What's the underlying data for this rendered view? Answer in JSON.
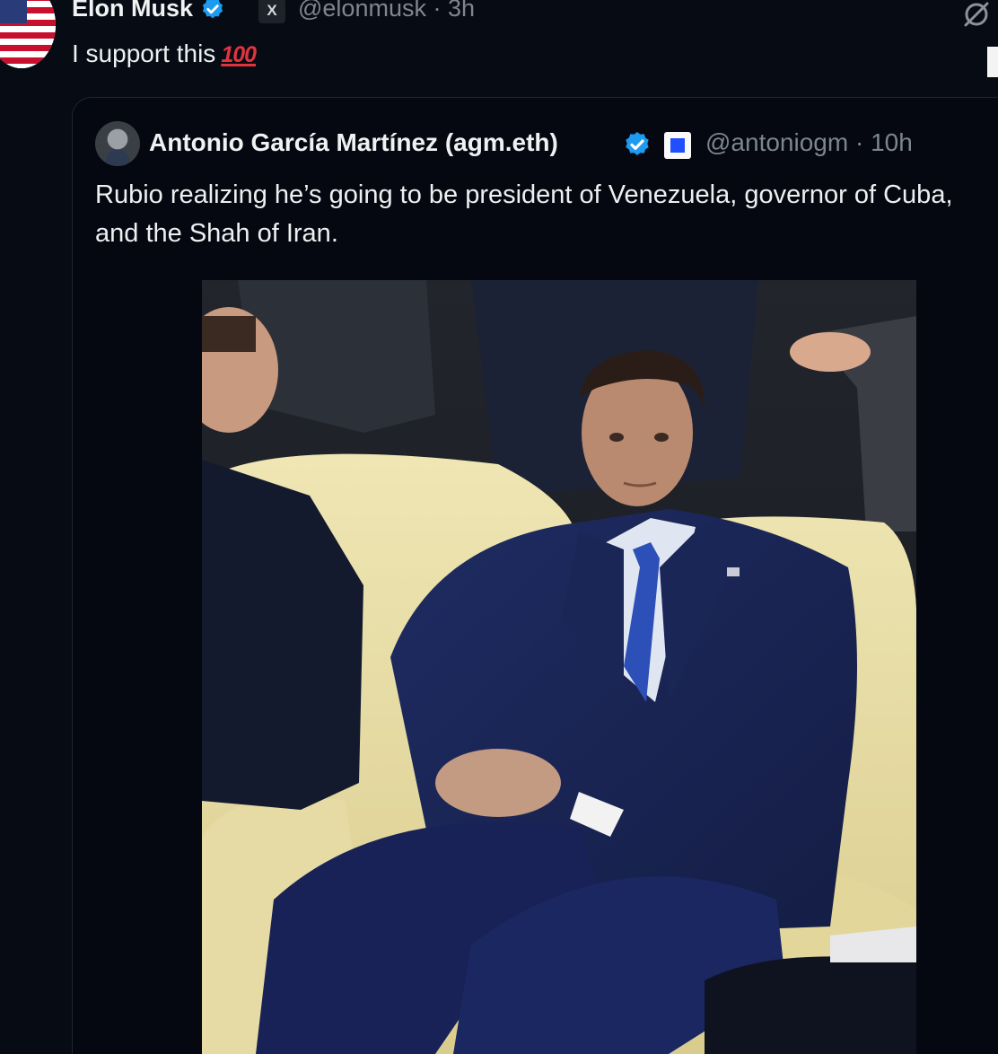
{
  "outer_tweet": {
    "name": "Elon Musk",
    "badge_letter": "X",
    "handle_time": "@elonmusk · 3h",
    "text": "I support this",
    "emoji": "100"
  },
  "quoted_tweet": {
    "name": "Antonio García Martínez (agm.eth)",
    "handle_time": "@antoniogm · 10h",
    "text": "Rubio realizing he’s going to be president of Venezuela, governor of Cuba, and the Shah of Iran."
  },
  "icons": {
    "verified": "verified-badge-icon",
    "grok": "grok-icon",
    "flag": "us-flag-avatar"
  },
  "colors": {
    "background": "#070b14",
    "verified_blue": "#1d9bf0",
    "handle_gray": "#7e868e",
    "hundred_red": "#e0343f"
  }
}
